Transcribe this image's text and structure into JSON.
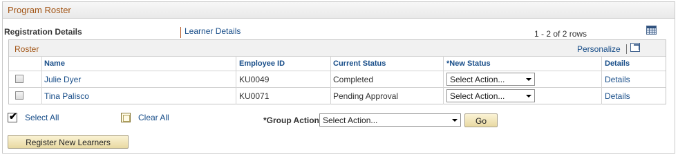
{
  "section": {
    "title": "Program Roster"
  },
  "tabs": {
    "active": "Registration Details",
    "other": "Learner Details"
  },
  "pagination": {
    "row_count": "1 - 2 of 2 rows"
  },
  "grid": {
    "title": "Roster",
    "personalize": "Personalize",
    "columns": [
      "Name",
      "Employee ID",
      "Current Status",
      "*New Status",
      "Details"
    ],
    "rows": [
      {
        "name": "Julie Dyer",
        "employee_id": "KU0049",
        "current_status": "Completed",
        "new_status": "Select Action...",
        "details": "Details",
        "checked": false
      },
      {
        "name": "Tina Palisco",
        "employee_id": "KU0071",
        "current_status": "Pending Approval",
        "new_status": "Select Action...",
        "details": "Details",
        "checked": false
      }
    ]
  },
  "actions": {
    "select_all": "Select All",
    "clear_all": "Clear All",
    "group_action_label": "*Group Action",
    "group_action_value": "Select Action...",
    "go": "Go",
    "register": "Register New Learners"
  },
  "colors": {
    "section_title": "#a15313",
    "link": "#164c88",
    "button_bg": "#f3e7b8"
  },
  "icons": [
    "grid-download-icon",
    "popout-icon",
    "checkbox-icon",
    "dropdown-arrow-icon"
  ]
}
